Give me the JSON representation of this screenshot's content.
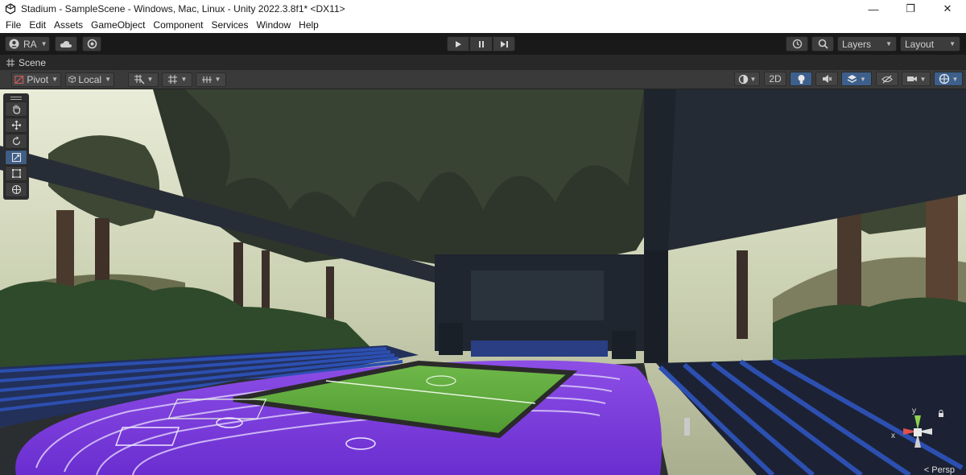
{
  "window": {
    "title": "Stadium - SampleScene - Windows, Mac, Linux - Unity 2022.3.8f1* <DX11>",
    "minimize": "—",
    "maximize": "❐",
    "close": "✕"
  },
  "menu": [
    "File",
    "Edit",
    "Assets",
    "GameObject",
    "Component",
    "Services",
    "Window",
    "Help"
  ],
  "toolbar": {
    "account_label": "RA",
    "layers_label": "Layers",
    "layout_label": "Layout"
  },
  "tabs": [
    {
      "label": "Scene"
    }
  ],
  "scene_toolbar": {
    "pivot_label": "Pivot",
    "local_label": "Local",
    "mode_2d_label": "2D"
  },
  "viewport": {
    "projection_label": "< Persp",
    "axis_x": "x",
    "axis_y": "y"
  },
  "colors": {
    "track": "#7b35d9",
    "field": "#5aa63a",
    "seats": "#2c4fb0",
    "sky": "#d8ddc8",
    "active_button": "#3d5f8c"
  }
}
